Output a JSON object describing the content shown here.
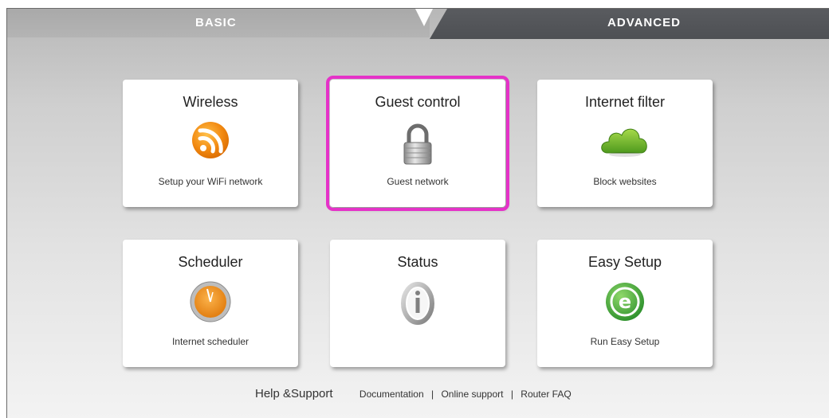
{
  "tabs": {
    "basic": "BASIC",
    "advanced": "ADVANCED"
  },
  "cards": [
    {
      "title": "Wireless",
      "subtitle": "Setup your WiFi network",
      "icon": "wifi-icon"
    },
    {
      "title": "Guest control",
      "subtitle": "Guest network",
      "icon": "lock-icon",
      "selected": true
    },
    {
      "title": "Internet filter",
      "subtitle": "Block websites",
      "icon": "cloud-icon"
    },
    {
      "title": "Scheduler",
      "subtitle": "Internet scheduler",
      "icon": "clock-icon"
    },
    {
      "title": "Status",
      "subtitle": "",
      "icon": "info-icon"
    },
    {
      "title": "Easy Setup",
      "subtitle": "Run Easy Setup",
      "icon": "easy-setup-icon"
    }
  ],
  "footer": {
    "help": "Help &Support",
    "links": [
      "Documentation",
      "Online support",
      "Router FAQ"
    ],
    "separator": "|"
  },
  "colors": {
    "selected_outline": "#e532c8",
    "advanced_tab": "#55575b",
    "wifi_orange": "#f08a10",
    "cloud_green": "#6fb52c",
    "easy_green": "#3aa33a"
  }
}
